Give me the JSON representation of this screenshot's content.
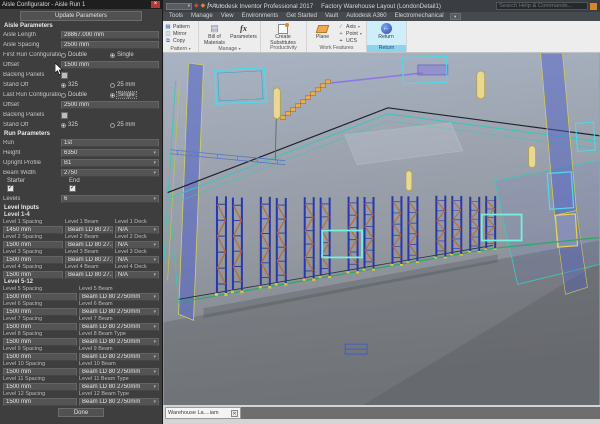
{
  "window": {
    "title_app": "Autodesk Inventor Professional 2017",
    "title_doc": "Factory Warehouse Layout (LondonDetail1)",
    "search_placeholder": "Search Help & Commands..."
  },
  "ribbon": {
    "tabs": [
      "Tools",
      "Manage",
      "View",
      "Environments",
      "Get Started",
      "Vault",
      "Autodesk A360",
      "Electromechanical"
    ],
    "pattern_group": {
      "label": "Pattern",
      "pattern": "Pattern",
      "mirror": "Mirror",
      "copy": "Copy"
    },
    "manage_group": {
      "label": "Manage",
      "bom": "Bill of Materials",
      "parameters": "Parameters"
    },
    "productivity_group": {
      "label": "Productivity",
      "create_substitutes": "Create Substitutes"
    },
    "work_group": {
      "label": "Work Features",
      "plane": "Plane",
      "axis": "Axis",
      "point": "Point",
      "ucs": "UCS"
    },
    "return_group": {
      "label": "Return",
      "return_btn": "Return"
    }
  },
  "dialog": {
    "title": "Aisle Configurator - Aisle Run 1",
    "update_button": "Update Parameters",
    "aisle": {
      "header": "Aisle Parameters",
      "aisle_length_label": "Aisle Length",
      "aisle_length": "28867.000 mm",
      "aisle_spacing_label": "Aisle Spacing",
      "aisle_spacing": "2500 mm",
      "first_run_label": "First Run Configuration",
      "double_label": "Double",
      "single_label": "Single",
      "offset1_label": "Offset",
      "offset1": "1500 mm",
      "backing_label": "Backing Panels",
      "standoff_label": "Stand Off",
      "standoff_opt1": "325",
      "standoff_opt2": "25 mm",
      "last_run_label": "Last Run Configuration",
      "offset2_label": "Offset",
      "offset2": "2500 mm"
    },
    "run": {
      "header": "Run Parameters",
      "run_label": "Run",
      "run": "1st",
      "height_label": "Height",
      "height": "6350",
      "upright_label": "Upright Profile",
      "upright": "B1",
      "beam_width_label": "Beam Width",
      "beam_width": "2750",
      "starter_label": "Starter",
      "end_label": "End",
      "levels_label": "Levels",
      "levels": "6"
    },
    "level_inputs": {
      "header": "Level Inputs",
      "group_a": "Level 1-4",
      "group_b": "Level 5-12",
      "levels_a": [
        {
          "spacing_label": "Level 1 Spacing",
          "spacing": "1450 mm",
          "beam_label": "Level 1 Beam",
          "beam": "Beam LD 80 27...",
          "deck_label": "Level 1 Deck",
          "deck": "N/A"
        },
        {
          "spacing_label": "Level 2 Spacing",
          "spacing": "1500 mm",
          "beam_label": "Level 2 Beam",
          "beam": "Beam LD 80 27...",
          "deck_label": "Level 2 Deck",
          "deck": "N/A"
        },
        {
          "spacing_label": "Level 3 Spacing",
          "spacing": "1500 mm",
          "beam_label": "Level 3 Beam",
          "beam": "Beam LD 80 27...",
          "deck_label": "Level 3 Deck",
          "deck": "N/A"
        },
        {
          "spacing_label": "Level 4 Spacing",
          "spacing": "1500 mm",
          "beam_label": "Level 4 Beam",
          "beam": "Beam LD 80 27...",
          "deck_label": "Level 4 Deck",
          "deck": "N/A"
        }
      ],
      "levels_b": [
        {
          "spacing_label": "Level 5 Spacing",
          "spacing": "1500 mm",
          "beam_label": "Level 5 Beam",
          "beam": "Beam LD 80 2750mm"
        },
        {
          "spacing_label": "Level 6 Spacing",
          "spacing": "1500 mm",
          "beam_label": "Level 6 Beam",
          "beam": "Beam LD 80 2750mm"
        },
        {
          "spacing_label": "Level 7 Spacing",
          "spacing": "1500 mm",
          "beam_label": "Level 7 Beam",
          "beam": "Beam LD 80 2750mm"
        },
        {
          "spacing_label": "Level 8 Spacing",
          "spacing": "1500 mm",
          "beam_label": "Level 8 Beam Type",
          "beam": "Beam LD 80 2750mm"
        },
        {
          "spacing_label": "Level 9 Spacing",
          "spacing": "1500 mm",
          "beam_label": "Level 9 Beam",
          "beam": "Beam LD 80 2750mm"
        },
        {
          "spacing_label": "Level 10 Spacing",
          "spacing": "1500 mm",
          "beam_label": "Level 10 Beam",
          "beam": "Beam LD 80 2750mm"
        },
        {
          "spacing_label": "Level 11 Spacing",
          "spacing": "1500 mm",
          "beam_label": "Level 11 Beam Type",
          "beam": "Beam LD 80 2750mm"
        },
        {
          "spacing_label": "Level 12 Spacing",
          "spacing": "1500 mm",
          "beam_label": "Level 12 Beam Type",
          "beam": "Beam LD 80 2750mm"
        }
      ]
    },
    "done_button": "Done"
  },
  "bottom": {
    "doc_tab": "Warehouse La....iam"
  },
  "colors": {
    "selection": "#74f2dc",
    "panel_blue": "#5560c8",
    "edge_cyan": "#4fd8ea",
    "edge_teal": "#3ec8b4",
    "rack_blue": "#2838a8",
    "bracing_orange": "#c06828",
    "ribbon_highlight": "#cfeefb"
  }
}
